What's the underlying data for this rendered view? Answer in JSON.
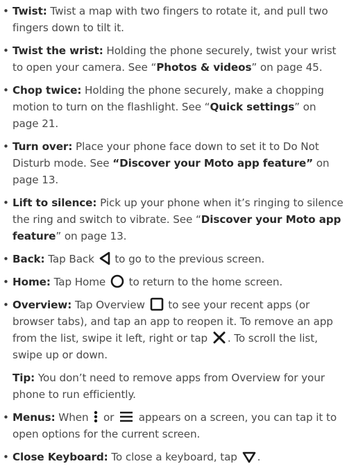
{
  "items": {
    "twist": {
      "term": "Twist:",
      "text": " Twist a map with two fingers to rotate it, and pull two fingers down to tilt it."
    },
    "twist_wrist": {
      "term": "Twist the wrist:",
      "text1": " Holding the phone securely, twist your wrist to open your camera. See “",
      "link": "Photos & videos",
      "text2": "” on page 45."
    },
    "chop": {
      "term": "Chop twice:",
      "text1": " Holding the phone securely, make a chopping motion to turn on the flashlight. See “",
      "link": "Quick settings",
      "text2": "” on page 21."
    },
    "turn_over": {
      "term": "Turn over:",
      "text1": " Place your phone face down to set it to Do Not Disturb mode. See ",
      "link": "“Discover your Moto app feature”",
      "text2": " on page 13."
    },
    "lift": {
      "term": "Lift to silence:",
      "text1": " Pick up your phone when it’s ringing to silence the ring and switch to vibrate. See “",
      "link": "Discover your Moto app feature",
      "text2": "” on page 13."
    },
    "back": {
      "term": "Back:",
      "text1": " Tap Back",
      "text2": " to go to the previous screen."
    },
    "home": {
      "term": "Home:",
      "text1": " Tap Home",
      "text2": " to return to the home screen."
    },
    "overview": {
      "term": "Overview:",
      "text1": " Tap Overview",
      "text2": " to see your recent apps (or browser tabs), and tap an app to reopen it. To remove an app from the list, swipe it left, right or tap",
      "text3": ". To scroll the list, swipe up or down."
    },
    "tip": {
      "term": "Tip:",
      "text": "  You don’t need to remove apps from Overview for your phone to run efficiently."
    },
    "menus": {
      "term": "Menus:",
      "text1": " When",
      "text2": " or",
      "text3": " appears on a screen, you can tap it to open options for the current screen."
    },
    "close_keyboard": {
      "term": "Close Keyboard:",
      "text1": " To close a keyboard, tap",
      "text2": "."
    }
  },
  "bullet": "•",
  "icons": {
    "back": "back-triangle-icon",
    "home": "home-circle-icon",
    "overview": "overview-square-icon",
    "close": "close-x-icon",
    "menu_vertical": "menu-vertical-dots-icon",
    "menu_lines": "menu-lines-icon",
    "keyboard_close": "keyboard-close-triangle-icon"
  }
}
